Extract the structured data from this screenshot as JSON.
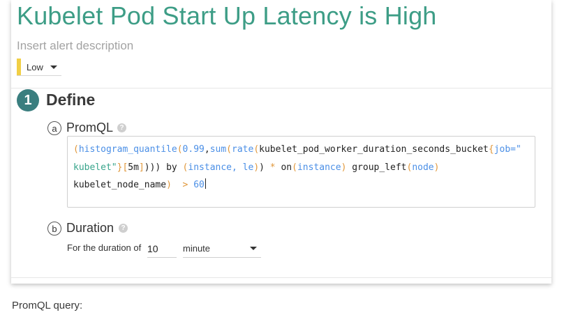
{
  "alert": {
    "title": "Kubelet Pod Start Up Latency is High",
    "description_placeholder": "Insert alert description",
    "severity": {
      "label": "Low",
      "color": "#f1cf45"
    }
  },
  "step": {
    "number": "1",
    "title": "Define"
  },
  "promql": {
    "marker": "a",
    "label": "PromQL",
    "help_icon": "help-icon",
    "lines": [
      [
        {
          "t": "(",
          "c": "p"
        },
        {
          "t": "histogram_quantile",
          "c": "f"
        },
        {
          "t": "(",
          "c": "p"
        },
        {
          "t": "0.99",
          "c": "n"
        },
        {
          "t": ",",
          "c": "i"
        },
        {
          "t": "sum",
          "c": "f"
        },
        {
          "t": "(",
          "c": "p"
        },
        {
          "t": "rate",
          "c": "f"
        },
        {
          "t": "(",
          "c": "p"
        },
        {
          "t": "kubelet_pod_worker_duration_seconds_bucket",
          "c": "i"
        },
        {
          "t": "{",
          "c": "p"
        },
        {
          "t": "job=\"",
          "c": "f"
        }
      ],
      [
        {
          "t": "kubelet\"",
          "c": "s"
        },
        {
          "t": "}",
          "c": "p"
        },
        {
          "t": "[",
          "c": "p"
        },
        {
          "t": "5m",
          "c": "i"
        },
        {
          "t": "]",
          "c": "p"
        },
        {
          "t": "))) ",
          "c": "i"
        },
        {
          "t": "by",
          "c": "i"
        },
        {
          "t": " (",
          "c": "p"
        },
        {
          "t": "instance, le",
          "c": "f"
        },
        {
          "t": ")",
          "c": "p"
        },
        {
          "t": ") ",
          "c": "i"
        },
        {
          "t": "*",
          "c": "p"
        },
        {
          "t": " on",
          "c": "i"
        },
        {
          "t": "(",
          "c": "p"
        },
        {
          "t": "instance",
          "c": "f"
        },
        {
          "t": ")",
          "c": "p"
        },
        {
          "t": " group_left",
          "c": "i"
        },
        {
          "t": "(",
          "c": "p"
        },
        {
          "t": "node",
          "c": "f"
        },
        {
          "t": ")",
          "c": "p"
        }
      ],
      [
        {
          "t": "kubelet_node_name",
          "c": "i"
        },
        {
          "t": ")",
          "c": "p"
        },
        {
          "t": "  > ",
          "c": "p"
        },
        {
          "t": "60",
          "c": "n"
        }
      ]
    ]
  },
  "duration": {
    "marker": "b",
    "label": "Duration",
    "help_icon": "help-icon",
    "for_label": "For the duration of",
    "value": "10",
    "unit": "minute"
  },
  "footer": {
    "text": "PromQL query:"
  }
}
